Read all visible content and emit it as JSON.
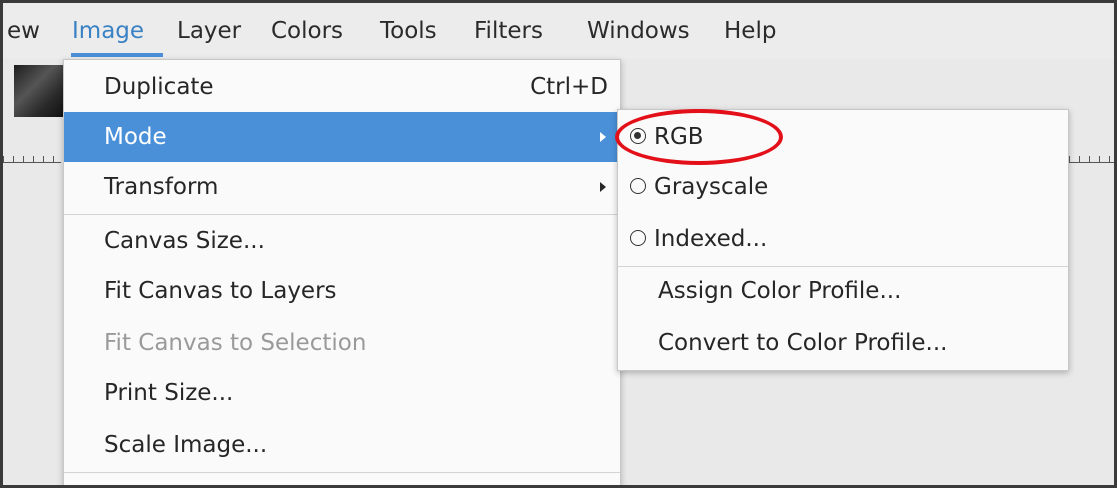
{
  "menubar": {
    "items": [
      {
        "label": "ew"
      },
      {
        "label": "Image"
      },
      {
        "label": "Layer"
      },
      {
        "label": "Colors"
      },
      {
        "label": "Tools"
      },
      {
        "label": "Filters"
      },
      {
        "label": "Windows"
      },
      {
        "label": "Help"
      }
    ]
  },
  "image_menu": {
    "items": [
      {
        "label": "Duplicate",
        "accel": "Ctrl+D"
      },
      {
        "label": "Mode"
      },
      {
        "label": "Transform"
      },
      {
        "label": "Canvas Size..."
      },
      {
        "label": "Fit Canvas to Layers"
      },
      {
        "label": "Fit Canvas to Selection"
      },
      {
        "label": "Print Size..."
      },
      {
        "label": "Scale Image..."
      }
    ]
  },
  "mode_submenu": {
    "items": [
      {
        "label": "RGB",
        "checked": true
      },
      {
        "label": "Grayscale",
        "checked": false
      },
      {
        "label": "Indexed...",
        "checked": false
      },
      {
        "label": "Assign Color Profile..."
      },
      {
        "label": "Convert to Color Profile..."
      }
    ]
  },
  "colors": {
    "accent": "#4a90d9",
    "annotation": "#e3101a"
  }
}
